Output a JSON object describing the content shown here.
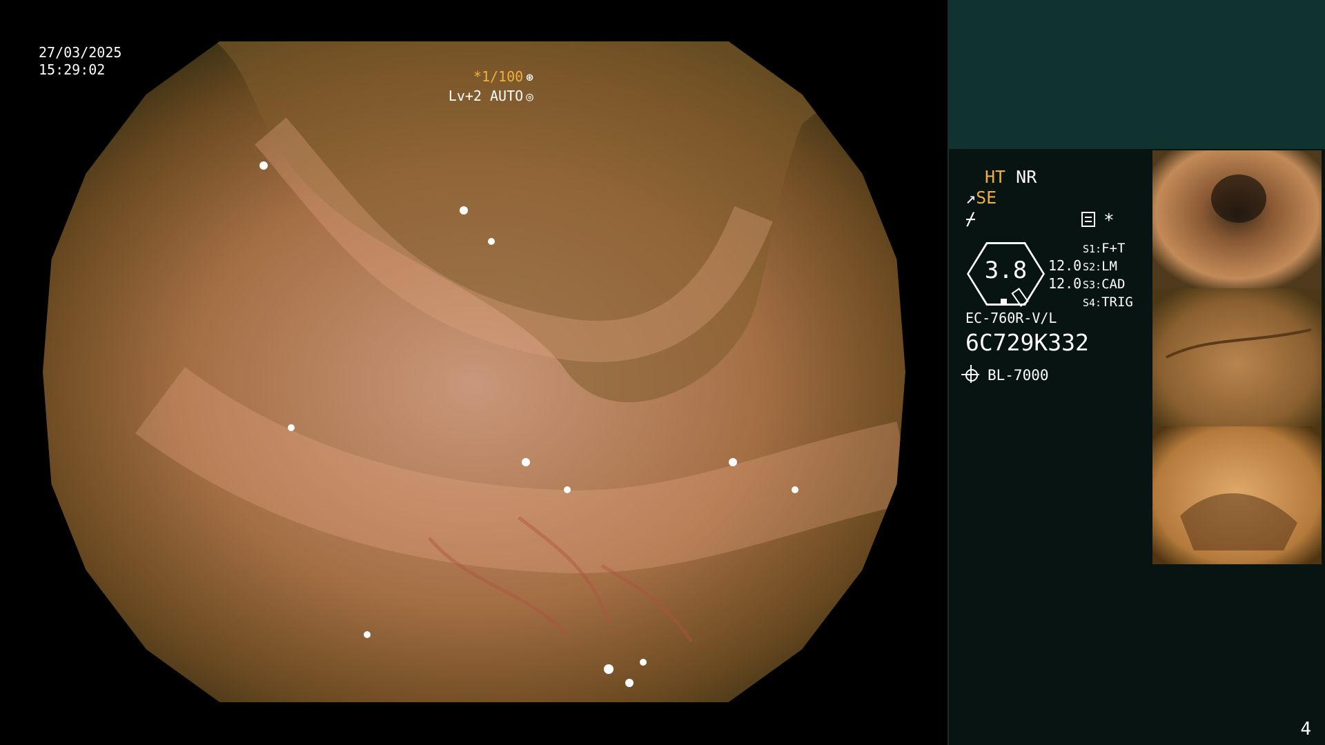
{
  "overlay": {
    "date": "27/03/2025",
    "time": "15:29:02",
    "exposure": "*1/100",
    "level": "Lv+2 AUTO"
  },
  "side": {
    "mode_ht": "HT",
    "mode_nr": "NR",
    "se_label": "SE",
    "gauge_value": "3.8",
    "gain_1": "12.0",
    "gain_2": "12.0",
    "slots": [
      {
        "key": "S1:",
        "value": "F+T"
      },
      {
        "key": "S2:",
        "value": "LM"
      },
      {
        "key": "S3:",
        "value": "CAD"
      },
      {
        "key": "S4:",
        "value": "TRIG"
      }
    ],
    "scope_model": "EC-760R-V/L",
    "serial": "6C729K332",
    "light_source": "BL-7000"
  },
  "thumbnails": [
    "thumbnail-1",
    "thumbnail-2",
    "thumbnail-3"
  ],
  "page_number": "4",
  "colors": {
    "accent": "#f0b040",
    "panel": "#081412",
    "panel_top": "#103330"
  }
}
